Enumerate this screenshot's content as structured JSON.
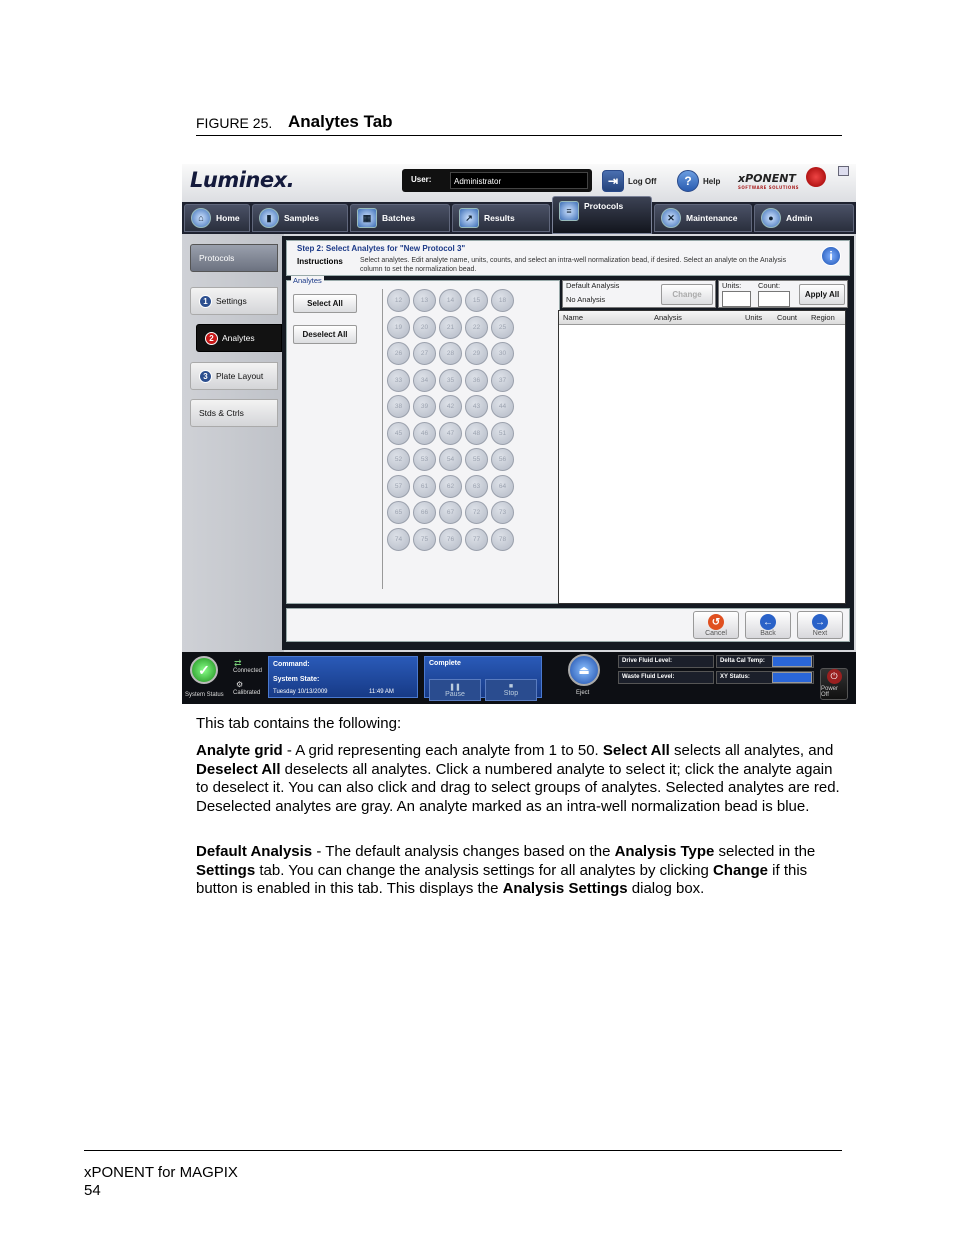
{
  "figure": {
    "number": "FIGURE 25.",
    "title": "Analytes Tab"
  },
  "app": {
    "logo": "Luminex.",
    "user_label": "User:",
    "user_value": "Administrator",
    "logoff_label": "Log Off",
    "help_label": "Help",
    "brand": "xPONENT",
    "brand_sub": "SOFTWARE SOLUTIONS",
    "tabs": [
      "Home",
      "Samples",
      "Batches",
      "Results",
      "Protocols",
      "Maintenance",
      "Admin"
    ],
    "side_items": [
      "Protocols",
      "Settings",
      "Analytes",
      "Plate Layout",
      "Stds & Ctrls"
    ],
    "side_steps": [
      "1",
      "2",
      "3"
    ],
    "instructions": {
      "title": "Step 2: Select Analytes for \"New Protocol 3\"",
      "label": "Instructions",
      "text": "Select analytes. Edit analyte name, units, counts, and select an intra-well normalization bead, if desired. Select an analyte on the Analysis column to set the normalization bead."
    },
    "analytes_group": "Analytes",
    "select_all": "Select All",
    "deselect_all": "Deselect All",
    "analyte_numbers": [
      "12",
      "13",
      "14",
      "15",
      "18",
      "19",
      "20",
      "21",
      "22",
      "25",
      "26",
      "27",
      "28",
      "29",
      "30",
      "33",
      "34",
      "35",
      "36",
      "37",
      "38",
      "39",
      "42",
      "43",
      "44",
      "45",
      "46",
      "47",
      "48",
      "51",
      "52",
      "53",
      "54",
      "55",
      "56",
      "57",
      "61",
      "62",
      "63",
      "64",
      "65",
      "66",
      "67",
      "72",
      "73",
      "74",
      "75",
      "76",
      "77",
      "78"
    ],
    "default_analysis_label": "Default Analysis",
    "default_analysis_value": "No Analysis",
    "change_button": "Change",
    "units_label": "Units:",
    "count_label": "Count:",
    "apply_all": "Apply All",
    "table_headers": [
      "Name",
      "Analysis",
      "Units",
      "Count",
      "Region"
    ],
    "nav": {
      "cancel": "Cancel",
      "back": "Back",
      "next": "Next"
    },
    "status": {
      "system_status": "System Status",
      "connected": "Connected",
      "calibrated": "Calibrated",
      "command": "Command:",
      "system_state": "System State:",
      "date": "Tuesday 10/13/2009",
      "time": "11:49 AM",
      "complete": "Complete",
      "pause": "Pause",
      "stop": "Stop",
      "eject": "Eject",
      "drive_fluid": "Drive Fluid Level:",
      "waste_fluid": "Waste Fluid Level:",
      "delta_cal": "Delta Cal Temp:",
      "xy_status": "XY Status:",
      "power_off": "Power Off"
    }
  },
  "body": {
    "intro": "This tab contains the following:",
    "p1_term": "Analyte grid",
    "p1_a": " - A grid representing each analyte from 1 to 50. ",
    "p1_b_term": "Select All",
    "p1_c": " selects all analytes, and ",
    "p1_d_term": "Deselect All",
    "p1_e": " deselects all analytes. Click a numbered analyte to select it; click the analyte again to deselect it. You can also click and drag to select groups of analytes. Selected analytes are red. Deselected analytes are gray. An analyte marked as an intra-well normalization bead is blue.",
    "p2_term": "Default Analysis",
    "p2_a": " - The default analysis changes based on the ",
    "p2_b_term": "Analysis Type",
    "p2_c": " selected in the ",
    "p2_d_term": "Settings",
    "p2_e": " tab. You can change the analysis settings for all analytes by clicking ",
    "p2_f_term": "Change",
    "p2_g": " if this button is enabled in this tab. This displays the ",
    "p2_h_term": "Analysis Settings",
    "p2_i": " dialog box."
  },
  "footer": {
    "product": "xPONENT for MAGPIX",
    "page": "54"
  },
  "colors": {
    "accent_blue": "#1c3a88",
    "selected_red": "#c71818",
    "status_green": "#1a8a1a"
  }
}
